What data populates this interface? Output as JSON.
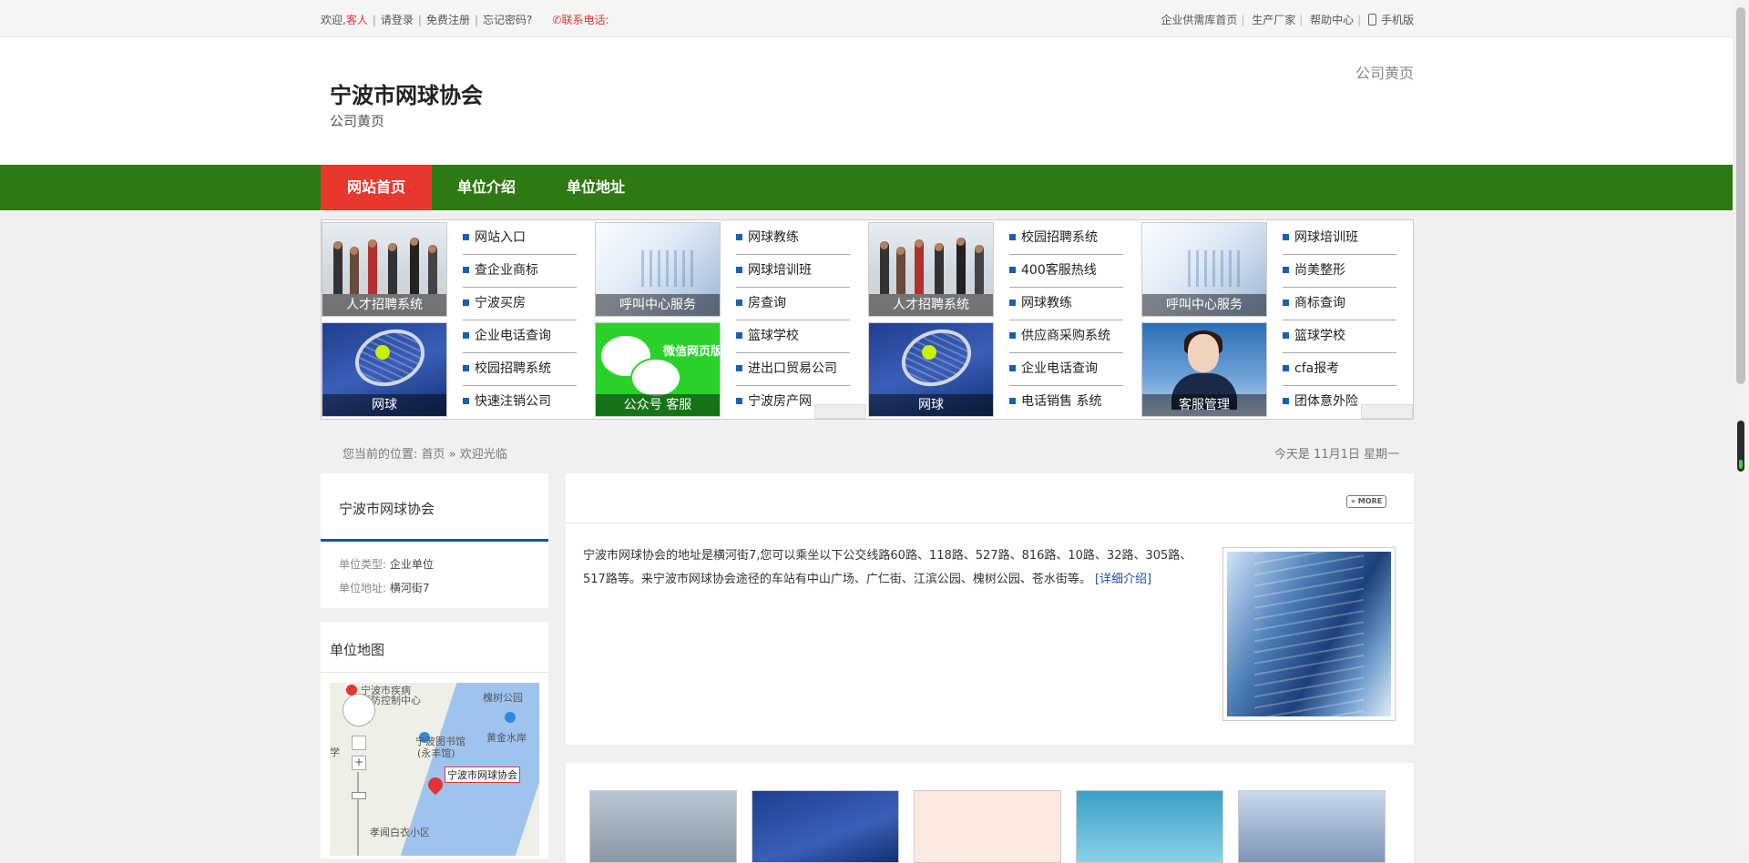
{
  "topbar": {
    "welcome": "欢迎,",
    "guest": "客人",
    "login": "请登录",
    "register": "免费注册",
    "forgot": "忘记密码?",
    "phone_label": "✆联系电话:",
    "right_links": [
      "企业供需库首页",
      "生产厂家",
      "帮助中心",
      "手机版"
    ]
  },
  "header": {
    "title": "宁波市网球协会",
    "subtitle": "公司黄页",
    "right_text": "公司黄页"
  },
  "nav": {
    "items": [
      "网站首页",
      "单位介绍",
      "单位地址"
    ],
    "active_index": 0
  },
  "ads": [
    {
      "images": [
        {
          "caption": "人才招聘系统",
          "art": "people"
        },
        {
          "caption": "网球",
          "art": "tennis"
        }
      ],
      "links": [
        "网站入口",
        "查企业商标",
        "宁波买房",
        "企业电话查询",
        "校园招聘系统",
        "快速注销公司"
      ]
    },
    {
      "images": [
        {
          "caption": "呼叫中心服务",
          "art": "call"
        },
        {
          "caption": "公众号 客服",
          "art": "wechat",
          "overlay": "微信网页版"
        }
      ],
      "links": [
        "网球教练",
        "网球培训班",
        "房查询",
        "篮球学校",
        "进出口贸易公司",
        "宁波房产网"
      ]
    },
    {
      "images": [
        {
          "caption": "人才招聘系统",
          "art": "people"
        },
        {
          "caption": "网球",
          "art": "tennis"
        }
      ],
      "links": [
        "校园招聘系统",
        "400客服热线",
        "网球教练",
        "供应商采购系统",
        "企业电话查询",
        "电话销售 系统"
      ]
    },
    {
      "images": [
        {
          "caption": "呼叫中心服务",
          "art": "call"
        },
        {
          "caption": "客服管理",
          "art": "agent"
        }
      ],
      "links": [
        "网球培训班",
        "尚美整形",
        "商标查询",
        "篮球学校",
        "cfa报考",
        "团体意外险"
      ]
    }
  ],
  "breadcrumb": {
    "label": "您当前的位置:",
    "home": "首页",
    "sep": " » ",
    "current": "欢迎光临"
  },
  "today": "今天是 11月1日 星期一",
  "sidebar": {
    "company_name": "宁波市网球协会",
    "type_label": "单位类型:",
    "type_value": "企业单位",
    "address_label": "单位地址:",
    "address_value": "横河街7",
    "map_title": "单位地图",
    "map_labels": {
      "l1": "宁波市疾病",
      "l2": "预防控制中心",
      "l3": "槐树公园",
      "l4": "黄金水岸",
      "l5": "宁波图书馆",
      "l6": "(永丰馆)",
      "l7": "孝闻白衣小区",
      "l8": "学",
      "pin": "宁波市网球协会"
    }
  },
  "main": {
    "more_label": "» MORE",
    "description": "宁波市网球协会的地址是横河街7,您可以乘坐以下公交线路60路、118路、527路、816路、10路、32路、305路、517路等。来宁波市网球协会途径的车站有中山广场、广仁街、江滨公园、槐树公园、苍水街等。",
    "detail_link": "[详细介绍]"
  },
  "colors": {
    "nav_bg": "#2e7a12",
    "nav_active": "#e8382e",
    "accent_blue": "#1a4ea8",
    "guest_red": "#e33333"
  }
}
